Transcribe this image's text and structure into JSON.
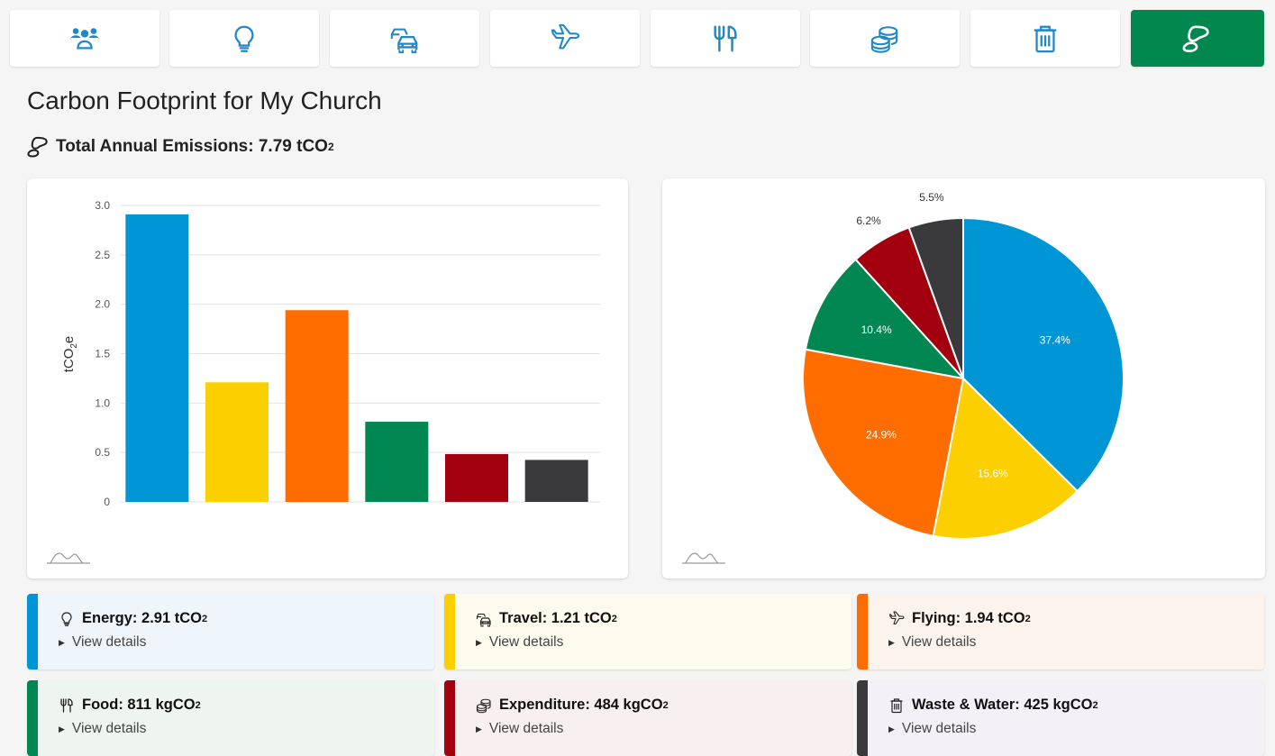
{
  "tabs": [
    {
      "icon": "people-icon",
      "name": "tab-people"
    },
    {
      "icon": "lightbulb-icon",
      "name": "tab-energy"
    },
    {
      "icon": "cars-icon",
      "name": "tab-travel"
    },
    {
      "icon": "airplane-icon",
      "name": "tab-flying"
    },
    {
      "icon": "fork-knife-icon",
      "name": "tab-food"
    },
    {
      "icon": "coins-icon",
      "name": "tab-expenditure"
    },
    {
      "icon": "trash-icon",
      "name": "tab-waste"
    },
    {
      "icon": "footprint-icon",
      "name": "tab-summary",
      "active": true
    }
  ],
  "page": {
    "title": "Carbon Footprint for My Church",
    "total_label": "Total Annual Emissions: 7.79 tCO",
    "total_sub": "2"
  },
  "colors": {
    "accent": "#00884f",
    "energy": "#0096d6",
    "travel": "#fcd000",
    "flying": "#ff6d00",
    "food": "#008752",
    "expenditure": "#a3000f",
    "waste": "#3a3a3c"
  },
  "chart_data": [
    {
      "type": "bar",
      "ylabel": "tCO",
      "ylabel_sub": "2",
      "ylabel_suffix": "e",
      "ylim": [
        0,
        3.0
      ],
      "ticks": [
        "0",
        "0.5",
        "1.0",
        "1.5",
        "2.0",
        "2.5",
        "3.0"
      ],
      "tick_values": [
        0,
        0.5,
        1.0,
        1.5,
        2.0,
        2.5,
        3.0
      ],
      "grid": true,
      "values": [
        2.91,
        1.21,
        1.94,
        0.811,
        0.484,
        0.425
      ],
      "colors": [
        "#0096d6",
        "#fcd000",
        "#ff6d00",
        "#008752",
        "#a3000f",
        "#3a3a3c"
      ]
    },
    {
      "type": "pie",
      "values": [
        37.4,
        15.6,
        24.9,
        10.4,
        6.2,
        5.5
      ],
      "labels": [
        "37.4%",
        "15.6%",
        "24.9%",
        "10.4%",
        "6.2%",
        "5.5%"
      ],
      "colors": [
        "#0096d6",
        "#fcd000",
        "#ff6d00",
        "#008752",
        "#a3000f",
        "#3a3a3c"
      ]
    }
  ],
  "categories": [
    {
      "icon": "lightbulb-icon",
      "label": "Energy: 2.91 tCO",
      "sub": "2",
      "details": "View details",
      "color": "#0096d6",
      "bg": "#eef6fb"
    },
    {
      "icon": "cars-icon",
      "label": "Travel: 1.21 tCO",
      "sub": "2",
      "details": "View details",
      "color": "#fcd000",
      "bg": "#fdfbee"
    },
    {
      "icon": "airplane-icon",
      "label": "Flying: 1.94 tCO",
      "sub": "2",
      "details": "View details",
      "color": "#ff6d00",
      "bg": "#fcf3ed"
    },
    {
      "icon": "fork-knife-icon",
      "label": "Food: 811 kgCO",
      "sub": "2",
      "details": "View details",
      "color": "#008752",
      "bg": "#eef5f1"
    },
    {
      "icon": "coins-icon",
      "label": "Expenditure: 484 kgCO",
      "sub": "2",
      "details": "View details",
      "color": "#a3000f",
      "bg": "#f8eff1"
    },
    {
      "icon": "trash-icon",
      "label": "Waste & Water: 425 kgCO",
      "sub": "2",
      "details": "View details",
      "color": "#3a3a3c",
      "bg": "#f3f1f6"
    }
  ]
}
